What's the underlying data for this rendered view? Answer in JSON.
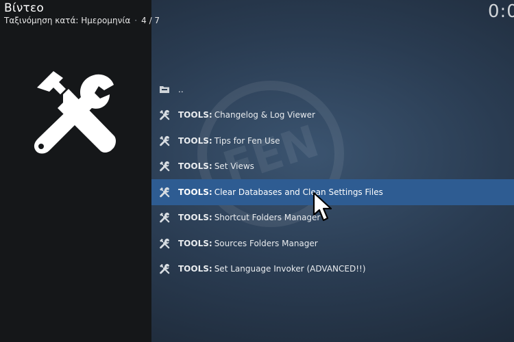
{
  "header": {
    "title": "Βίντεο",
    "sort_label": "Ταξινόμηση κατά: Ημερομηνία",
    "separator": "·",
    "position": "4 / 7",
    "clock": "0:0"
  },
  "hero_icon": "tools-icon",
  "list": {
    "parent": {
      "label": "..",
      "icon": "folder-back-icon"
    },
    "items": [
      {
        "prefix": "TOOLS:",
        "label": "Changelog & Log Viewer",
        "icon": "tools-icon"
      },
      {
        "prefix": "TOOLS:",
        "label": "Tips for Fen Use",
        "icon": "tools-icon"
      },
      {
        "prefix": "TOOLS:",
        "label": "Set Views",
        "icon": "tools-icon"
      },
      {
        "prefix": "TOOLS:",
        "label": "Clear Databases and Clean Settings Files",
        "icon": "tools-icon",
        "selected": true
      },
      {
        "prefix": "TOOLS:",
        "label": "Shortcut Folders Manager",
        "icon": "tools-icon"
      },
      {
        "prefix": "TOOLS:",
        "label": "Sources Folders Manager",
        "icon": "tools-icon"
      },
      {
        "prefix": "TOOLS:",
        "label": "Set Language Invoker (ADVANCED!!)",
        "icon": "tools-icon"
      }
    ]
  },
  "watermark_text": "FEN",
  "colors": {
    "selection": "#2e5c92",
    "left_panel": "#151719",
    "background": "#2a3c52"
  }
}
